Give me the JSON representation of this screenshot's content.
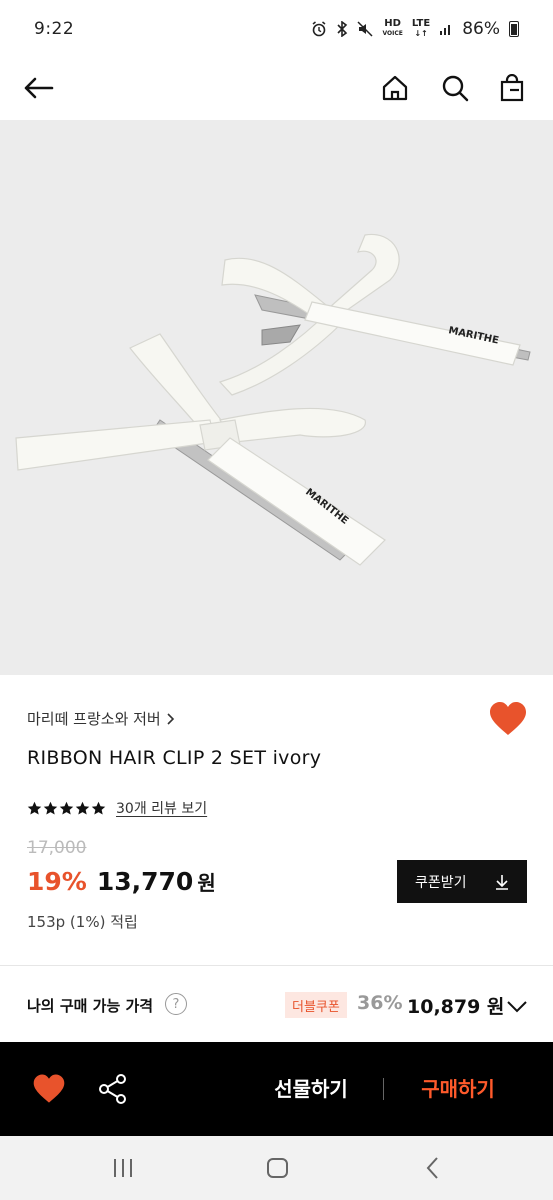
{
  "status_bar": {
    "time": "9:22",
    "hd_label": "HD",
    "voice_label": "VOICE",
    "lte_label": "LTE",
    "battery": "86%"
  },
  "product": {
    "brand": "마리떼 프랑소와 저버",
    "name": "RIBBON HAIR CLIP 2 SET ivory",
    "image_text": "MARITHE",
    "review_link": "30개 리뷰 보기",
    "rating_stars": 5,
    "original_price": "17,000",
    "discount": "19%",
    "sale_price": "13,770",
    "currency": "원",
    "points": "153p (1%) 적립",
    "coupon_button": "쿠폰받기"
  },
  "my_price": {
    "label": "나의 구매 가능 가격",
    "help": "?",
    "badge": "더블쿠폰",
    "discount": "36%",
    "final_price": "10,879 원"
  },
  "action_bar": {
    "gift": "선물하기",
    "buy": "구매하기"
  },
  "colors": {
    "accent": "#e8532c",
    "buy": "#ff5a2b",
    "image_bg": "#ececec"
  },
  "icons": [
    "back-arrow-icon",
    "home-icon",
    "search-icon",
    "shopping-bag-icon",
    "heart-icon",
    "share-icon",
    "download-icon",
    "chevron-down-icon",
    "chevron-right-icon"
  ]
}
